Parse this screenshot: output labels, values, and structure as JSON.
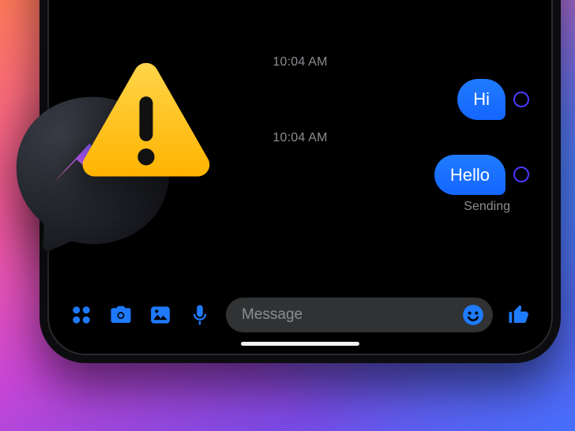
{
  "timestamps": {
    "t1": "10:04 AM",
    "t2": "10:04 AM"
  },
  "messages": {
    "m1": "Hi",
    "m2": "Hello"
  },
  "status": {
    "sending": "Sending"
  },
  "composer": {
    "placeholder": "Message",
    "value": ""
  },
  "icons": {
    "apps": "apps-grid-icon",
    "camera": "camera-icon",
    "photo": "photo-icon",
    "mic": "mic-icon",
    "emoji": "emoji-icon",
    "like": "thumbs-up-icon",
    "messenger": "messenger-logo-icon",
    "warning": "warning-icon"
  },
  "colors": {
    "accent": "#1f7bff",
    "bubble_grad_top": "#1f7bff",
    "bubble_grad_bot": "#1566ff",
    "receipt_ring": "#4a3aff",
    "warn_fill": "#ffc107"
  }
}
